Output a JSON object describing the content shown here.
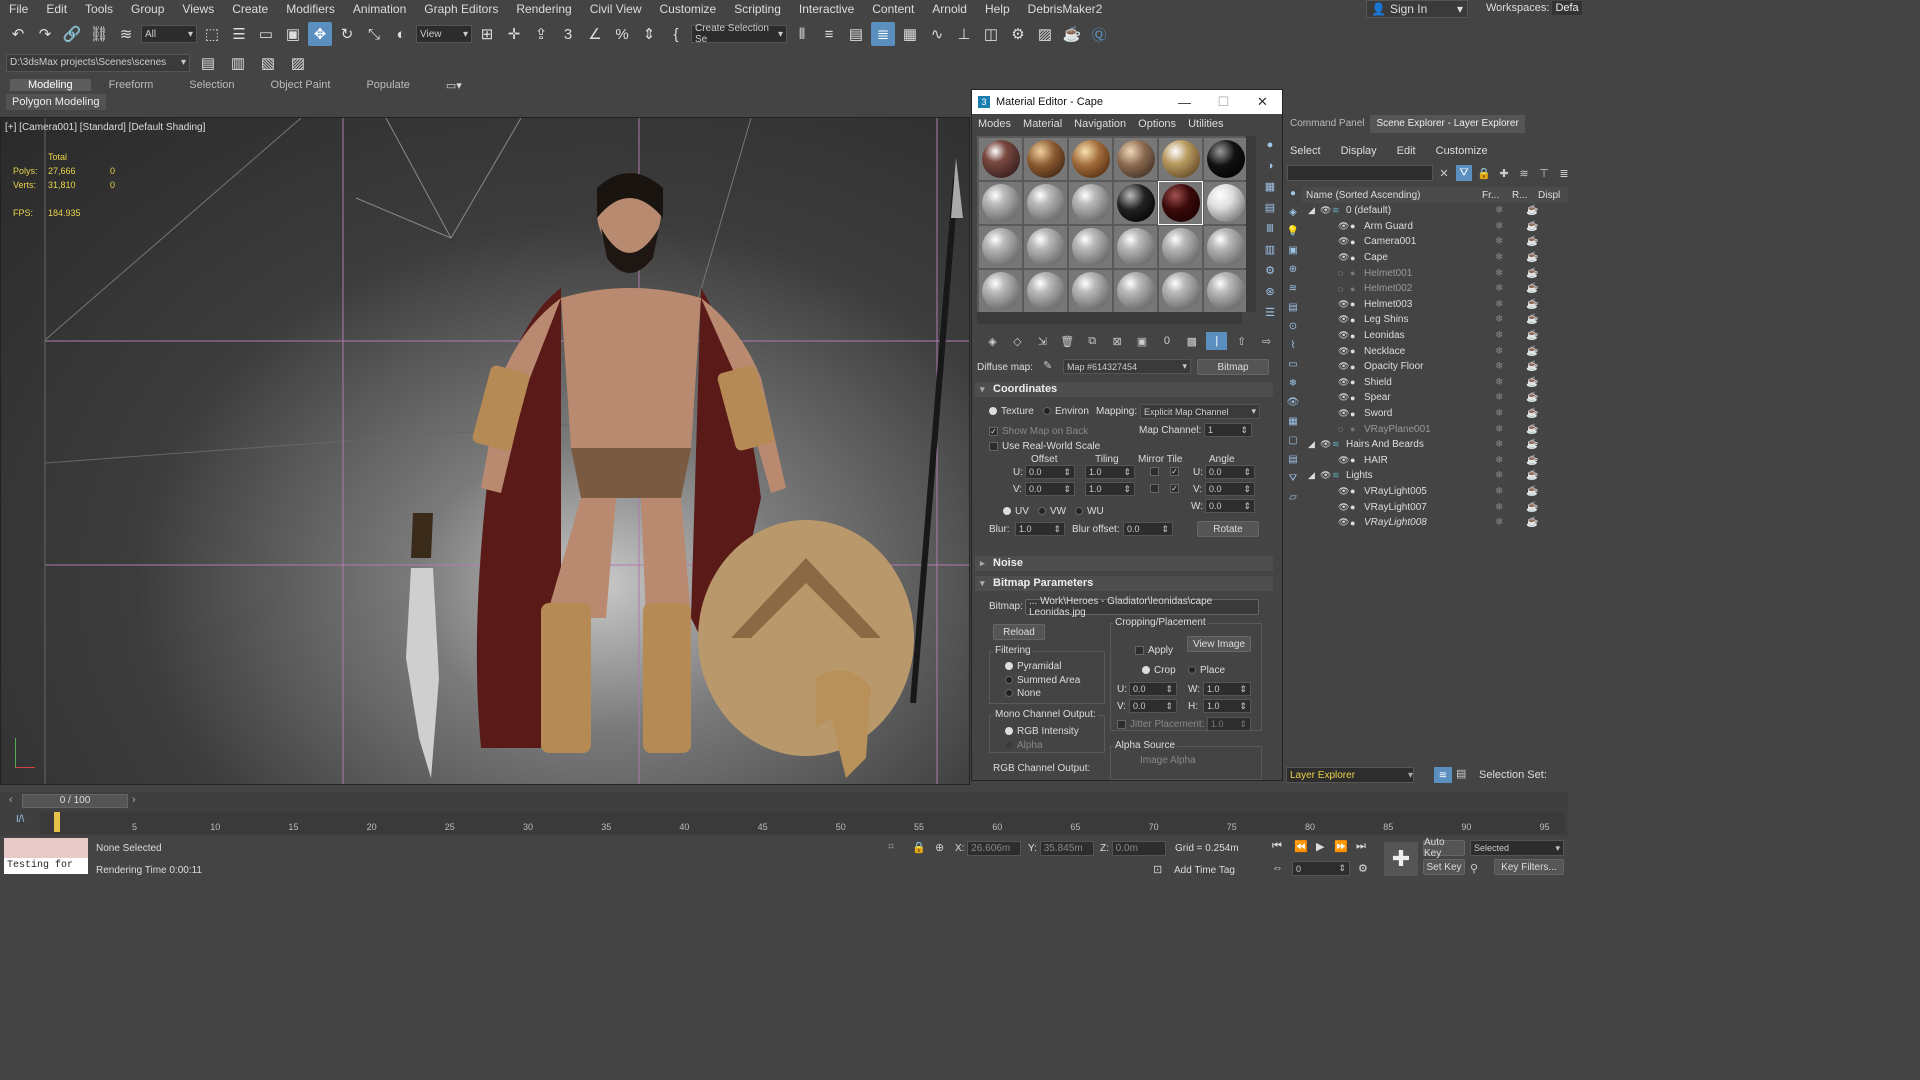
{
  "menu": [
    "File",
    "Edit",
    "Tools",
    "Group",
    "Views",
    "Create",
    "Modifiers",
    "Animation",
    "Graph Editors",
    "Rendering",
    "Civil View",
    "Customize",
    "Scripting",
    "Interactive",
    "Content",
    "Arnold",
    "Help",
    "DebrisMaker2"
  ],
  "account": {
    "signin": "Sign In",
    "workspaces_label": "Workspaces:",
    "workspace_value": "Defa"
  },
  "toolbar": {
    "filter": "All",
    "refcoord": "View",
    "selection_set": "Create Selection Se"
  },
  "project_path": "D:\\3dsMax projects\\Scenes\\scenes",
  "ribbon": {
    "tabs": [
      "Modeling",
      "Freeform",
      "Selection",
      "Object Paint",
      "Populate"
    ],
    "active": "Modeling",
    "sub": "Polygon Modeling"
  },
  "viewport": {
    "label": "[+] [Camera001] [Standard] [Default Shading]",
    "stats": {
      "total": "Total",
      "polys_k": "Polys:",
      "polys": "27,666",
      "polys_sel": "0",
      "verts_k": "Verts:",
      "verts": "31,810",
      "verts_sel": "0",
      "fps_k": "FPS:",
      "fps": "184.935"
    }
  },
  "material_editor": {
    "title": "Material Editor - Cape",
    "menu": [
      "Modes",
      "Material",
      "Navigation",
      "Options",
      "Utilities"
    ],
    "diffuse_label": "Diffuse map:",
    "map_name": "Map #614327454",
    "map_type": "Bitmap",
    "coordinates": {
      "title": "Coordinates",
      "texture": "Texture",
      "environ": "Environ",
      "mapping_label": "Mapping:",
      "mapping": "Explicit Map Channel",
      "show_map_back": "Show Map on Back",
      "map_channel_label": "Map Channel:",
      "map_channel": "1",
      "real_world": "Use Real-World Scale",
      "offset": "Offset",
      "tiling": "Tiling",
      "mirror_tile": "Mirror Tile",
      "angle": "Angle",
      "u_label": "U:",
      "v_label": "V:",
      "w_label": "W:",
      "u_offset": "0.0",
      "v_offset": "0.0",
      "u_tiling": "1.0",
      "v_tiling": "1.0",
      "u_angle": "0.0",
      "v_angle": "0.0",
      "w_angle": "0.0",
      "uv": "UV",
      "vw": "VW",
      "wu": "WU",
      "blur_label": "Blur:",
      "blur": "1.0",
      "blur_offset_label": "Blur offset:",
      "blur_offset": "0.0",
      "rotate": "Rotate"
    },
    "noise": {
      "title": "Noise"
    },
    "bitmap_params": {
      "title": "Bitmap Parameters",
      "bitmap_label": "Bitmap:",
      "bitmap_path": "... Work\\Heroes - Gladiator\\leonidas\\cape Leonidas.jpg",
      "reload": "Reload",
      "cropping": "Cropping/Placement",
      "apply": "Apply",
      "view_image": "View Image",
      "crop": "Crop",
      "place": "Place",
      "u_label": "U:",
      "v_label": "V:",
      "w_label": "W:",
      "h_label": "H:",
      "u": "0.0",
      "v": "0.0",
      "w": "1.0",
      "h": "1.0",
      "jitter_label": "Jitter Placement:",
      "jitter": "1.0",
      "filtering": "Filtering",
      "pyramidal": "Pyramidal",
      "summed_area": "Summed Area",
      "none": "None",
      "mono_output": "Mono Channel Output:",
      "rgb_intensity": "RGB Intensity",
      "alpha": "Alpha",
      "rgb_output": "RGB Channel Output:",
      "alpha_source": "Alpha Source",
      "image_alpha": "Image Alpha"
    }
  },
  "scene_explorer": {
    "tabs": [
      "Command Panel",
      "Scene Explorer - Layer Explorer"
    ],
    "menu": [
      "Select",
      "Display",
      "Edit",
      "Customize"
    ],
    "header": {
      "name": "Name (Sorted Ascending)",
      "col1": "Fr...",
      "col2": "R...",
      "col3": "Displ"
    },
    "rows": [
      {
        "name": "0 (default)",
        "indent": 0,
        "type": "layer"
      },
      {
        "name": "Arm Guard",
        "indent": 1
      },
      {
        "name": "Camera001",
        "indent": 1
      },
      {
        "name": "Cape",
        "indent": 1
      },
      {
        "name": "Helmet001",
        "indent": 1,
        "dim": true
      },
      {
        "name": "Helmet002",
        "indent": 1,
        "dim": true
      },
      {
        "name": "Helmet003",
        "indent": 1
      },
      {
        "name": "Leg Shins",
        "indent": 1
      },
      {
        "name": "Leonidas",
        "indent": 1
      },
      {
        "name": "Necklace",
        "indent": 1
      },
      {
        "name": "Opacity Floor",
        "indent": 1
      },
      {
        "name": "Shield",
        "indent": 1
      },
      {
        "name": "Spear",
        "indent": 1
      },
      {
        "name": "Sword",
        "indent": 1
      },
      {
        "name": "VRayPlane001",
        "indent": 1,
        "dim": true
      },
      {
        "name": "Hairs And Beards",
        "indent": 0,
        "type": "layer"
      },
      {
        "name": "HAIR",
        "indent": 1
      },
      {
        "name": "Lights",
        "indent": 0,
        "type": "layer"
      },
      {
        "name": "VRayLight005",
        "indent": 1
      },
      {
        "name": "VRayLight007",
        "indent": 1
      },
      {
        "name": "VRayLight008",
        "indent": 1,
        "italic": true
      }
    ],
    "layer_explorer": "Layer Explorer",
    "selection_set_label": "Selection Set:"
  },
  "timeline": {
    "frame": "0 / 100",
    "ticks": [
      "5",
      "10",
      "15",
      "20",
      "25",
      "30",
      "35",
      "40",
      "45",
      "50",
      "55",
      "60",
      "65",
      "70",
      "75",
      "80",
      "85",
      "90",
      "95"
    ]
  },
  "status": {
    "maxscript": "Testing for",
    "selected": "None Selected",
    "render_time": "Rendering Time  0:00:11",
    "x_label": "X:",
    "x": "26.606m",
    "y_label": "Y:",
    "y": "35.845m",
    "z_label": "Z:",
    "z": "0.0m",
    "grid": "Grid = 0.254m",
    "add_time_tag": "Add Time Tag",
    "auto_key": "Auto Key",
    "set_key": "Set Key",
    "key_mode": "Selected",
    "key_filters": "Key Filters...",
    "frame_field": "0"
  }
}
